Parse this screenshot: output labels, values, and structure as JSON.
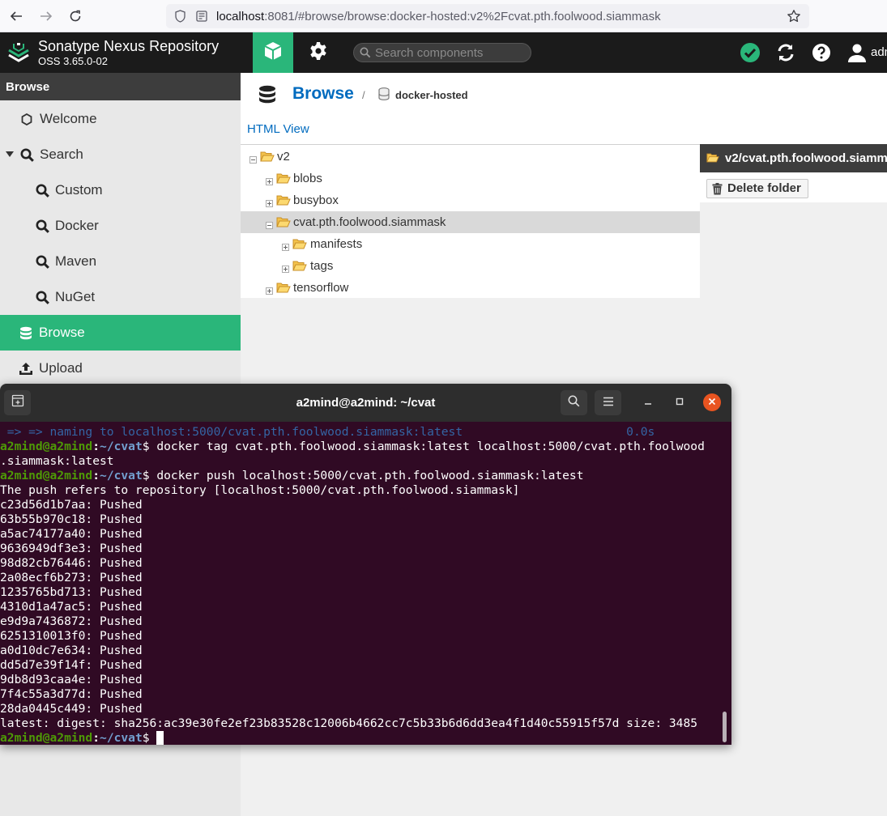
{
  "browser": {
    "url_host": "localhost",
    "url_rest": ":8081/#browse/browse:docker-hosted:v2%2Fcvat.pth.foolwood.siammask"
  },
  "nexus": {
    "title": "Sonatype Nexus Repository",
    "version": "OSS 3.65.0-02",
    "search_placeholder": "Search components",
    "user_label": "adm",
    "accent": "#2ab67a"
  },
  "sidebar": {
    "header": "Browse",
    "items": [
      {
        "label": "Welcome",
        "icon": "hexagon-icon"
      },
      {
        "label": "Search",
        "icon": "search-icon"
      },
      {
        "label": "Custom",
        "icon": "search-icon"
      },
      {
        "label": "Docker",
        "icon": "search-icon"
      },
      {
        "label": "Maven",
        "icon": "search-icon"
      },
      {
        "label": "NuGet",
        "icon": "search-icon"
      },
      {
        "label": "Browse",
        "icon": "database-icon"
      },
      {
        "label": "Upload",
        "icon": "upload-icon"
      }
    ]
  },
  "breadcrumb": {
    "root": "Browse",
    "separator": "/",
    "repo": "docker-hosted"
  },
  "html_view": "HTML View",
  "tree": {
    "items": [
      {
        "label": "v2"
      },
      {
        "label": "blobs"
      },
      {
        "label": "busybox"
      },
      {
        "label": "cvat.pth.foolwood.siammask"
      },
      {
        "label": "manifests"
      },
      {
        "label": "tags"
      },
      {
        "label": "tensorflow"
      }
    ]
  },
  "detail": {
    "path": "v2/cvat.pth.foolwood.siamm",
    "delete_label": "Delete folder"
  },
  "terminal": {
    "title": "a2mind@a2mind: ~/cvat",
    "prompt_user": "a2mind@a2mind",
    "prompt_sep": ":",
    "prompt_path": "~/cvat",
    "prompt_dollar": "$",
    "line0": " => => naming to localhost:5000/cvat.pth.foolwood.siammask:latest                       0.0s",
    "cmd1": " docker tag cvat.pth.foolwood.siammask:latest localhost:5000/cvat.pth.foolwood",
    "cmd1_wrap": ".siammask:latest",
    "cmd2": " docker push localhost:5000/cvat.pth.foolwood.siammask:latest",
    "push_refers": "The push refers to repository [localhost:5000/cvat.pth.foolwood.siammask]",
    "layers": [
      "c23d56d1b7aa: Pushed",
      "63b55b970c18: Pushed",
      "a5ac74177a40: Pushed",
      "9636949df3e3: Pushed",
      "98d82cb76446: Pushed",
      "2a08ecf6b273: Pushed",
      "1235765bd713: Pushed",
      "4310d1a47ac5: Pushed",
      "e9d9a7436872: Pushed",
      "6251310013f0: Pushed",
      "a0d10dc7e634: Pushed",
      "dd5d7e39f14f: Pushed",
      "9db8d93caa4e: Pushed",
      "7f4c55a3d77d: Pushed",
      "28da0445c449: Pushed"
    ],
    "digest_line": "latest: digest: sha256:ac39e30fe2ef23b83528c12006b4662cc7c5b33b6d6dd3ea4f1d40c55915f57d size: 3485",
    "bg": "#300a24"
  }
}
